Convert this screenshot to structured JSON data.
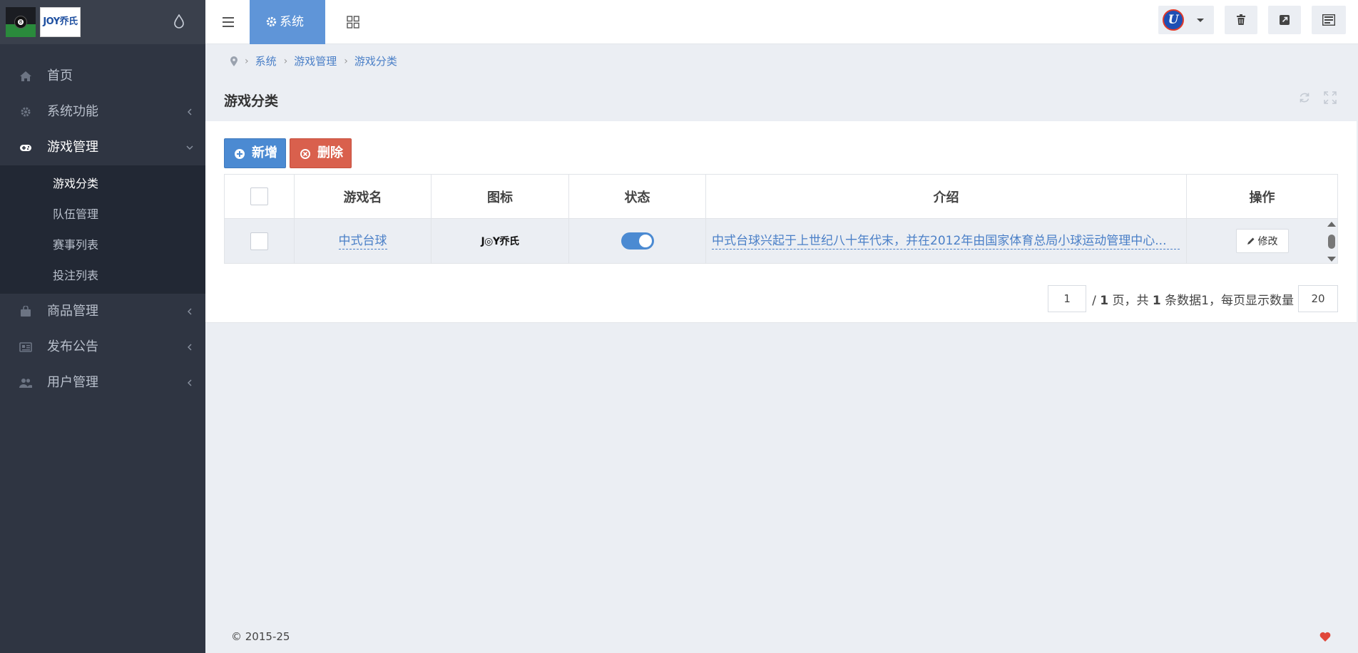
{
  "brand": {
    "logo_text": "JOY乔氏"
  },
  "sidebar": {
    "items": [
      {
        "label": "首页",
        "icon": "home-icon",
        "active": false
      },
      {
        "label": "系统功能",
        "icon": "gear-icon",
        "active": false
      },
      {
        "label": "游戏管理",
        "icon": "gamepad-icon",
        "active": true,
        "children": [
          {
            "label": "游戏分类",
            "active": true
          },
          {
            "label": "队伍管理"
          },
          {
            "label": "赛事列表"
          },
          {
            "label": "投注列表"
          }
        ]
      },
      {
        "label": "商品管理",
        "icon": "shopping-bag-icon",
        "active": false
      },
      {
        "label": "发布公告",
        "icon": "newspaper-icon",
        "active": false
      },
      {
        "label": "用户管理",
        "icon": "users-icon",
        "active": false
      }
    ]
  },
  "topbar": {
    "system_label": "系统",
    "avatar_letter": "U"
  },
  "breadcrumb": [
    "系统",
    "游戏管理",
    "游戏分类"
  ],
  "page": {
    "title": "游戏分类"
  },
  "toolbar": {
    "add_label": "新增",
    "delete_label": "删除"
  },
  "table": {
    "headers": [
      "游戏名",
      "图标",
      "状态",
      "介绍",
      "操作"
    ],
    "rows": [
      {
        "name": "中式台球",
        "icon_text": "J◎Y乔氏",
        "status": true,
        "intro": "中式台球兴起于上世纪八十年代末，并在2012年由国家体育总局小球运动管理中心...",
        "action": "修改"
      }
    ]
  },
  "pagination": {
    "current": "1",
    "text_pre": "/ ",
    "total_pages": "1",
    "text_mid": " 页，共 ",
    "total_records": "1",
    "text_post": " 条数据1，每页显示数量",
    "page_size": "20"
  },
  "footer": {
    "copyright": "© 2015-25"
  },
  "colors": {
    "accent": "#5f95d8",
    "danger": "#d9604d",
    "sidebar": "#2f3542",
    "link": "#4a7fc7"
  }
}
